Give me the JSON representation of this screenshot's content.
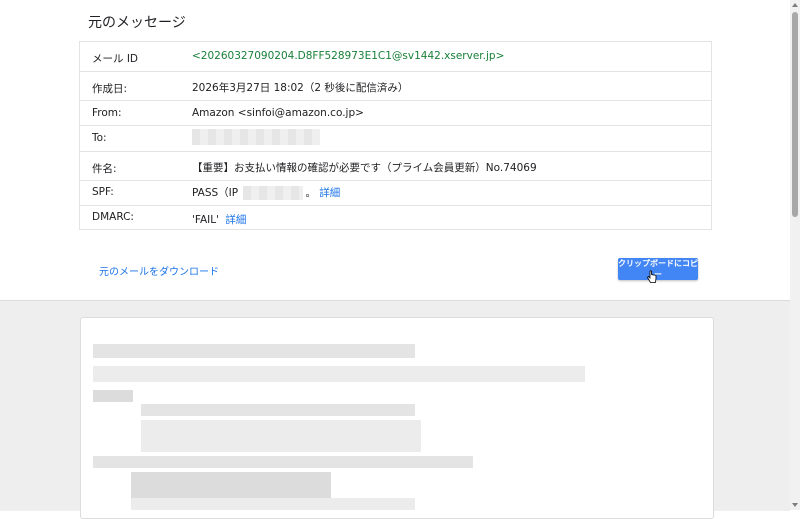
{
  "page": {
    "title": "元のメッセージ"
  },
  "headers": [
    {
      "key": "メール ID",
      "value": "<20260327090204.D8FF528973E1C1@sv1442.xserver.jp>"
    },
    {
      "key": "作成日:",
      "value": "2026年3月27日 18:02（2 秒後に配信済み）"
    },
    {
      "key": "From:",
      "value": "Amazon <sinfoi@amazon.co.jp>"
    },
    {
      "key": "To:",
      "value": ""
    },
    {
      "key": "件名:",
      "value": "【重要】お支払い情報の確認が必要です（プライム会員更新）No.74069"
    },
    {
      "key": "SPF:",
      "value_prefix": "PASS（IP",
      "value_suffix": "。",
      "link": "詳細"
    },
    {
      "key": "DMARC:",
      "value": "'FAIL'",
      "link": "詳細"
    }
  ],
  "actions": {
    "download_label": "元のメールをダウンロード",
    "copy_label": "クリップボードにコピー"
  },
  "colors": {
    "link": "#1a73e8",
    "message_id": "#188038",
    "button": "#4285f4"
  },
  "icons": {
    "cursor": "hand-pointer-icon"
  }
}
